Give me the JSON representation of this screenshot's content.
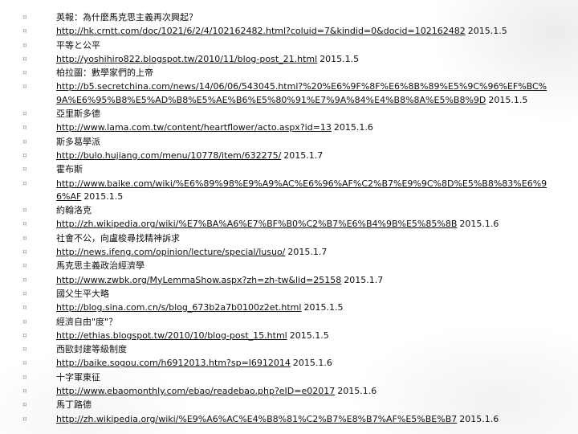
{
  "bullet_glyph": "¤",
  "entries": [
    {
      "kind": "title",
      "text": "英報：為什麼馬克思主義再次興起？"
    },
    {
      "kind": "link",
      "url": "http://hk.crntt.com/doc/1021/6/2/4/102162482.html?coluid=7&kindid=0&docid=102162482",
      "date": "2015.1.5"
    },
    {
      "kind": "title",
      "text": "平等と公平"
    },
    {
      "kind": "link",
      "url": "http://yoshihiro822.blogspot.tw/2010/11/blog-post_21.html",
      "date": "2015.1.5"
    },
    {
      "kind": "title",
      "text": "柏拉圖：數學家們的上帝"
    },
    {
      "kind": "link",
      "url": "http://b5.secretchina.com/news/14/06/06/543045.html?%20%E6%9F%8F%E6%8B%89%E5%9C%96%EF%BC%9A%E6%95%B8%E5%AD%B8%E5%AE%B6%E5%80%91%E7%9A%84%E4%B8%8A%E5%B8%9D",
      "date": "2015.1.5"
    },
    {
      "kind": "title",
      "text": "亞里斯多德"
    },
    {
      "kind": "link",
      "url": "http://www.lama.com.tw/content/heartflower/acto.aspx?id=13",
      "date": "2015.1.6"
    },
    {
      "kind": "title",
      "text": "斯多葛學派"
    },
    {
      "kind": "link",
      "url": "http://bulo.hujiang.com/menu/10778/item/632275/",
      "date": "2015.1.7"
    },
    {
      "kind": "title",
      "text": "霍布斯"
    },
    {
      "kind": "link",
      "url": "http://www.baike.com/wiki/%E6%89%98%E9%A9%AC%E6%96%AF%C2%B7%E9%9C%8D%E5%B8%83%E6%96%AF",
      "date": "2015.1.5"
    },
    {
      "kind": "title",
      "text": "約翰洛克"
    },
    {
      "kind": "link",
      "url": "http://zh.wikipedia.org/wiki/%E7%BA%A6%E7%BF%B0%C2%B7%E6%B4%9B%E5%85%8B",
      "date": "2015.1.6"
    },
    {
      "kind": "title",
      "text": "社會不公，向盧梭尋找精神訴求"
    },
    {
      "kind": "link",
      "url": "http://news.ifeng.com/opinion/lecture/special/lusuo/",
      "date": "2015.1.7"
    },
    {
      "kind": "title",
      "text": "馬克思主義政治經濟學"
    },
    {
      "kind": "link",
      "url": "http://www.zwbk.org/MyLemmaShow.aspx?zh=zh-tw&lid=25158",
      "date": "2015.1.7"
    },
    {
      "kind": "title",
      "text": "國父生平大略"
    },
    {
      "kind": "link",
      "url": "http://blog.sina.com.cn/s/blog_673b2a7b0100z2et.html",
      "date": "2015.1.5"
    },
    {
      "kind": "title",
      "text": "經濟自由\"度\"？"
    },
    {
      "kind": "link",
      "url": "http://ethias.blogspot.tw/2010/10/blog-post_15.html",
      "date": "2015.1.5"
    },
    {
      "kind": "title",
      "text": "西歐封建等級制度"
    },
    {
      "kind": "link",
      "url": "http://baike.sogou.com/h6912013.htm?sp=l6912014",
      "date": "2015.1.6"
    },
    {
      "kind": "title",
      "text": "十字軍東征"
    },
    {
      "kind": "link",
      "url": "http://www.ebaomonthly.com/ebao/readebao.php?eID=e02017",
      "date": "2015.1.6"
    },
    {
      "kind": "title",
      "text": "馬丁路德"
    },
    {
      "kind": "link",
      "url": "http://zh.wikipedia.org/wiki/%E9%A6%AC%E4%B8%81%C2%B7%E8%B7%AF%E5%BE%B7",
      "date": "2015.1.6"
    }
  ]
}
